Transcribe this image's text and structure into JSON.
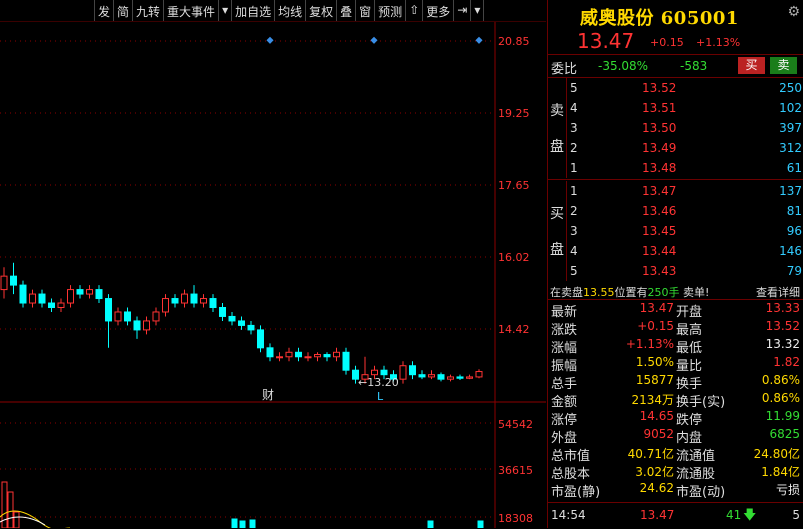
{
  "toolbar": {
    "items": [
      "发",
      "简",
      "九转",
      "重大事件",
      "▾",
      "加自选",
      "均线",
      "复权",
      "叠",
      "窗",
      "预测",
      "⇧",
      "更多",
      "⇥",
      "▾"
    ]
  },
  "chart": {
    "price_axis": [
      "20.85",
      "19.25",
      "17.65",
      "16.02",
      "14.42"
    ],
    "volume_axis": [
      "54542",
      "36615",
      "18308"
    ],
    "annotation_low": "←13.20",
    "marker_cai": "财",
    "marker_l": "L",
    "candles": [
      {
        "o": 15.3,
        "c": 15.6,
        "h": 15.8,
        "l": 15.1
      },
      {
        "o": 15.6,
        "c": 15.4,
        "h": 15.9,
        "l": 15.2
      },
      {
        "o": 15.4,
        "c": 15.0,
        "h": 15.5,
        "l": 14.9
      },
      {
        "o": 15.0,
        "c": 15.2,
        "h": 15.3,
        "l": 14.9
      },
      {
        "o": 15.2,
        "c": 15.0,
        "h": 15.3,
        "l": 14.9
      },
      {
        "o": 15.0,
        "c": 14.9,
        "h": 15.1,
        "l": 14.8
      },
      {
        "o": 14.9,
        "c": 15.0,
        "h": 15.1,
        "l": 14.8
      },
      {
        "o": 15.0,
        "c": 15.3,
        "h": 15.4,
        "l": 14.9
      },
      {
        "o": 15.3,
        "c": 15.2,
        "h": 15.4,
        "l": 15.1
      },
      {
        "o": 15.2,
        "c": 15.3,
        "h": 15.4,
        "l": 15.1
      },
      {
        "o": 15.3,
        "c": 15.1,
        "h": 15.4,
        "l": 15.0
      },
      {
        "o": 15.1,
        "c": 14.6,
        "h": 15.2,
        "l": 14.0
      },
      {
        "o": 14.6,
        "c": 14.8,
        "h": 14.9,
        "l": 14.5
      },
      {
        "o": 14.8,
        "c": 14.6,
        "h": 14.9,
        "l": 14.5
      },
      {
        "o": 14.6,
        "c": 14.4,
        "h": 14.7,
        "l": 14.2
      },
      {
        "o": 14.4,
        "c": 14.6,
        "h": 14.7,
        "l": 14.3
      },
      {
        "o": 14.6,
        "c": 14.8,
        "h": 14.9,
        "l": 14.5
      },
      {
        "o": 14.8,
        "c": 15.1,
        "h": 15.2,
        "l": 14.7
      },
      {
        "o": 15.1,
        "c": 15.0,
        "h": 15.2,
        "l": 14.9
      },
      {
        "o": 15.0,
        "c": 15.2,
        "h": 15.3,
        "l": 14.9
      },
      {
        "o": 15.2,
        "c": 15.0,
        "h": 15.4,
        "l": 14.9
      },
      {
        "o": 15.0,
        "c": 15.1,
        "h": 15.2,
        "l": 14.9
      },
      {
        "o": 15.1,
        "c": 14.9,
        "h": 15.2,
        "l": 14.8
      },
      {
        "o": 14.9,
        "c": 14.7,
        "h": 15.0,
        "l": 14.6
      },
      {
        "o": 14.7,
        "c": 14.6,
        "h": 14.8,
        "l": 14.5
      },
      {
        "o": 14.6,
        "c": 14.5,
        "h": 14.7,
        "l": 14.4
      },
      {
        "o": 14.5,
        "c": 14.4,
        "h": 14.6,
        "l": 14.3
      },
      {
        "o": 14.4,
        "c": 14.0,
        "h": 14.5,
        "l": 13.9
      },
      {
        "o": 14.0,
        "c": 13.8,
        "h": 14.1,
        "l": 13.7
      },
      {
        "o": 13.8,
        "c": 13.8,
        "h": 13.9,
        "l": 13.7
      },
      {
        "o": 13.8,
        "c": 13.9,
        "h": 14.0,
        "l": 13.7
      },
      {
        "o": 13.9,
        "c": 13.8,
        "h": 14.0,
        "l": 13.7
      },
      {
        "o": 13.8,
        "c": 13.8,
        "h": 13.9,
        "l": 13.7
      },
      {
        "o": 13.8,
        "c": 13.85,
        "h": 13.9,
        "l": 13.7
      },
      {
        "o": 13.85,
        "c": 13.8,
        "h": 13.9,
        "l": 13.7
      },
      {
        "o": 13.8,
        "c": 13.9,
        "h": 14.0,
        "l": 13.7
      },
      {
        "o": 13.9,
        "c": 13.5,
        "h": 14.0,
        "l": 13.4
      },
      {
        "o": 13.5,
        "c": 13.3,
        "h": 13.6,
        "l": 13.2
      },
      {
        "o": 13.3,
        "c": 13.4,
        "h": 13.8,
        "l": 13.2
      },
      {
        "o": 13.4,
        "c": 13.5,
        "h": 13.6,
        "l": 13.3
      },
      {
        "o": 13.5,
        "c": 13.4,
        "h": 13.6,
        "l": 13.3
      },
      {
        "o": 13.4,
        "c": 13.3,
        "h": 13.5,
        "l": 13.25
      },
      {
        "o": 13.3,
        "c": 13.6,
        "h": 13.7,
        "l": 13.2
      },
      {
        "o": 13.6,
        "c": 13.4,
        "h": 13.7,
        "l": 13.3
      },
      {
        "o": 13.4,
        "c": 13.35,
        "h": 13.5,
        "l": 13.3
      },
      {
        "o": 13.35,
        "c": 13.4,
        "h": 13.5,
        "l": 13.3
      },
      {
        "o": 13.4,
        "c": 13.3,
        "h": 13.45,
        "l": 13.25
      },
      {
        "o": 13.3,
        "c": 13.35,
        "h": 13.4,
        "l": 13.25
      },
      {
        "o": 13.35,
        "c": 13.32,
        "h": 13.4,
        "l": 13.28
      },
      {
        "o": 13.32,
        "c": 13.35,
        "h": 13.4,
        "l": 13.3
      },
      {
        "o": 13.35,
        "c": 13.47,
        "h": 13.52,
        "l": 13.32
      }
    ]
  },
  "stock": {
    "name": "威奥股份 605001",
    "price": "13.47",
    "change": "+0.15",
    "change_pct": "+1.13%"
  },
  "weibi": {
    "label": "委比",
    "pct": "-35.08%",
    "diff": "-583",
    "buy": "买",
    "sell": "卖"
  },
  "sell_side": {
    "chars": [
      "卖",
      "盘"
    ],
    "rows": [
      {
        "lv": "5",
        "price": "13.52",
        "vol": "250"
      },
      {
        "lv": "4",
        "price": "13.51",
        "vol": "102"
      },
      {
        "lv": "3",
        "price": "13.50",
        "vol": "397"
      },
      {
        "lv": "2",
        "price": "13.49",
        "vol": "312"
      },
      {
        "lv": "1",
        "price": "13.48",
        "vol": "61"
      }
    ]
  },
  "buy_side": {
    "chars": [
      "买",
      "盘"
    ],
    "rows": [
      {
        "lv": "1",
        "price": "13.47",
        "vol": "137"
      },
      {
        "lv": "2",
        "price": "13.46",
        "vol": "81"
      },
      {
        "lv": "3",
        "price": "13.45",
        "vol": "96"
      },
      {
        "lv": "4",
        "price": "13.44",
        "vol": "146"
      },
      {
        "lv": "5",
        "price": "13.43",
        "vol": "79"
      }
    ]
  },
  "note": {
    "prefix": "在卖盘",
    "price": "13.55",
    "mid": "位置有",
    "qty": "250手",
    "suffix": " 卖单!",
    "link": "查看详细"
  },
  "stats": [
    {
      "k1": "最新",
      "v1": "13.47",
      "c1": "red",
      "k2": "开盘",
      "v2": "13.33",
      "c2": "red"
    },
    {
      "k1": "涨跌",
      "v1": "+0.15",
      "c1": "red",
      "k2": "最高",
      "v2": "13.52",
      "c2": "red"
    },
    {
      "k1": "涨幅",
      "v1": "+1.13%",
      "c1": "red",
      "k2": "最低",
      "v2": "13.32",
      "c2": "wht"
    },
    {
      "k1": "振幅",
      "v1": "1.50%",
      "c1": "yel",
      "k2": "量比",
      "v2": "1.82",
      "c2": "red"
    },
    {
      "k1": "总手",
      "v1": "15877",
      "c1": "yel",
      "k2": "换手",
      "v2": "0.86%",
      "c2": "yel"
    },
    {
      "k1": "金额",
      "v1": "2134万",
      "c1": "yel",
      "k2": "换手(实)",
      "v2": "0.86%",
      "c2": "yel"
    },
    {
      "k1": "涨停",
      "v1": "14.65",
      "c1": "red",
      "k2": "跌停",
      "v2": "11.99",
      "c2": "green"
    },
    {
      "k1": "外盘",
      "v1": "9052",
      "c1": "red",
      "k2": "内盘",
      "v2": "6825",
      "c2": "green"
    },
    {
      "k1": "总市值",
      "v1": "40.71亿",
      "c1": "yel",
      "k2": "流通值",
      "v2": "24.80亿",
      "c2": "yel"
    },
    {
      "k1": "总股本",
      "v1": "3.02亿",
      "c1": "yel",
      "k2": "流通股",
      "v2": "1.84亿",
      "c2": "yel"
    },
    {
      "k1": "市盈(静)",
      "v1": "24.62",
      "c1": "yel",
      "k2": "市盈(动)",
      "v2": "亏损",
      "c2": "wht"
    }
  ],
  "tick": {
    "time": "14:54",
    "price": "13.47",
    "vol": "41",
    "num": "5"
  },
  "colors": {
    "up": "#ff3333",
    "down": "#00ffff",
    "axis": "#8b0000",
    "bg": "#000000"
  }
}
